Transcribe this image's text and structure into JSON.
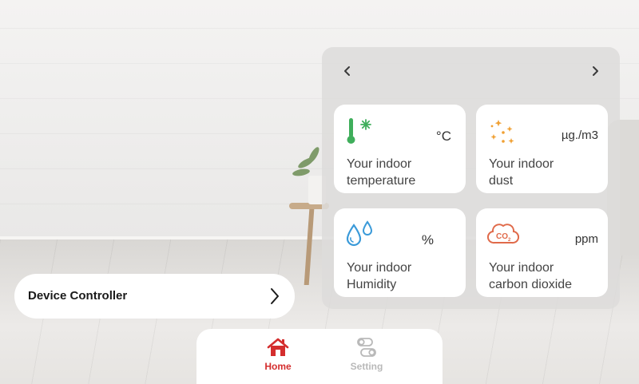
{
  "panel": {
    "prev_label": "‹",
    "next_label": "›",
    "cards": [
      {
        "icon": "thermometer-snow-icon",
        "unit": "°C",
        "label": "Your indoor\ntemperature",
        "accent": "#3fae5b"
      },
      {
        "icon": "dust-sparkle-icon",
        "unit": "µg./m3",
        "label": "Your indoor\ndust",
        "accent": "#f0a033"
      },
      {
        "icon": "water-drops-icon",
        "unit": "%",
        "label": "Your indoor\nHumidity",
        "accent": "#3a9ad9"
      },
      {
        "icon": "co2-cloud-icon",
        "unit": "ppm",
        "label": "Your indoor\ncarbon dioxide",
        "accent": "#e06a4a"
      }
    ]
  },
  "device_controller": {
    "label": "Device Controller"
  },
  "bottom_nav": {
    "items": [
      {
        "icon": "home-icon",
        "label": "Home",
        "active": true,
        "color": "#d42e2e"
      },
      {
        "icon": "setting-toggle-icon",
        "label": "Setting",
        "active": false,
        "color": "#b9b9b9"
      }
    ]
  }
}
